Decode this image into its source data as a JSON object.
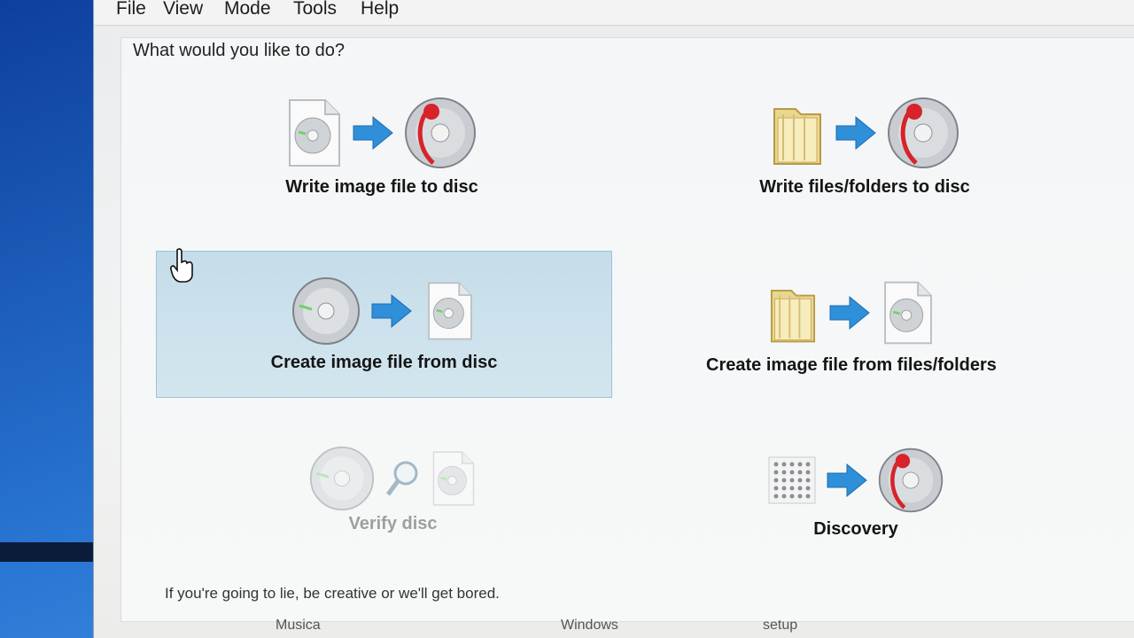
{
  "menu": [
    "File",
    "View",
    "Mode",
    "Tools",
    "Help"
  ],
  "prompt": "What would you like to do?",
  "tasks": {
    "write_image": "Write image file to disc",
    "write_files": "Write files/folders to disc",
    "create_image_disc": "Create image file from disc",
    "create_image_files": "Create image file from files/folders",
    "verify": "Verify disc",
    "discovery": "Discovery"
  },
  "tip": "If you're going to lie, be creative or we'll get bored.",
  "behind": [
    "Musica",
    "Windows",
    "setup"
  ],
  "colors": {
    "selected_bg": "#c5dde9",
    "arrow_blue": "#2f8fd8",
    "disc_red": "#d8232a"
  },
  "icons": [
    "disc-image-file-icon",
    "arrow-right-icon",
    "writable-disc-icon",
    "folder-icon",
    "disc-icon",
    "magnifier-icon",
    "dot-grid-icon",
    "hand-cursor-icon"
  ]
}
